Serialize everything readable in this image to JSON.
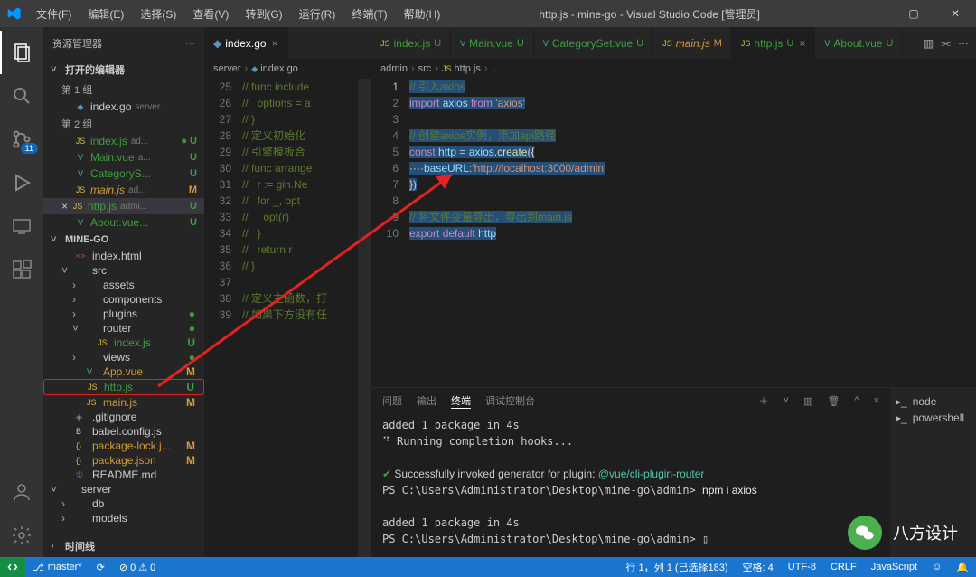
{
  "window": {
    "title": "http.js - mine-go - Visual Studio Code [管理员]"
  },
  "menubar": [
    "文件(F)",
    "编辑(E)",
    "选择(S)",
    "查看(V)",
    "转到(G)",
    "运行(R)",
    "终端(T)",
    "帮助(H)"
  ],
  "sidebar": {
    "title": "资源管理器",
    "open_editors": "打开的编辑器",
    "group1": "第 1 组",
    "group2": "第 2 组",
    "open_files_g1": [
      {
        "icon": "go",
        "name": "index.go",
        "path": "server",
        "status": ""
      }
    ],
    "open_files_g2": [
      {
        "icon": "js",
        "name": "index.js",
        "path": "ad...",
        "status": "U",
        "dot": true
      },
      {
        "icon": "vue",
        "name": "Main.vue",
        "path": "a...",
        "status": "U"
      },
      {
        "icon": "vue",
        "name": "CategoryS...",
        "path": "",
        "status": "U"
      },
      {
        "icon": "js",
        "name": "main.js",
        "path": "ad...",
        "status": "M",
        "italic": true
      },
      {
        "icon": "js",
        "name": "http.js",
        "path": "admi...",
        "status": "U",
        "active": true
      },
      {
        "icon": "vue",
        "name": "About.vue...",
        "path": "",
        "status": "U"
      }
    ],
    "workspace": "MINE-GO",
    "tree": [
      {
        "depth": 1,
        "icon": "html",
        "name": "index.html",
        "chev": ""
      },
      {
        "depth": 1,
        "icon": "folder",
        "name": "src",
        "chev": "v"
      },
      {
        "depth": 2,
        "icon": "folder",
        "name": "assets",
        "chev": ">"
      },
      {
        "depth": 2,
        "icon": "folder",
        "name": "components",
        "chev": ">"
      },
      {
        "depth": 2,
        "icon": "folder",
        "name": "plugins",
        "chev": ">",
        "dot": true
      },
      {
        "depth": 2,
        "icon": "folder",
        "name": "router",
        "chev": "v",
        "dot": true
      },
      {
        "depth": 3,
        "icon": "js",
        "name": "index.js",
        "status": "U"
      },
      {
        "depth": 2,
        "icon": "folder",
        "name": "views",
        "chev": ">",
        "dot": true
      },
      {
        "depth": 2,
        "icon": "vue",
        "name": "App.vue",
        "status": "M"
      },
      {
        "depth": 2,
        "icon": "js",
        "name": "http.js",
        "status": "U",
        "highlight": true
      },
      {
        "depth": 2,
        "icon": "js",
        "name": "main.js",
        "status": "M"
      },
      {
        "depth": 1,
        "icon": "git",
        "name": ".gitignore"
      },
      {
        "depth": 1,
        "icon": "js",
        "name": "babel.config.js",
        "iconChar": "B"
      },
      {
        "depth": 1,
        "icon": "json",
        "name": "package-lock.j...",
        "status": "M"
      },
      {
        "depth": 1,
        "icon": "json",
        "name": "package.json",
        "status": "M"
      },
      {
        "depth": 1,
        "icon": "md",
        "name": "README.md"
      },
      {
        "depth": 0,
        "icon": "folder",
        "name": "server",
        "chev": "v"
      },
      {
        "depth": 1,
        "icon": "folder",
        "name": "db",
        "chev": ">"
      },
      {
        "depth": 1,
        "icon": "folder",
        "name": "models",
        "chev": ">"
      }
    ],
    "timeline": "时间线"
  },
  "editor_left": {
    "tab": "index.go",
    "breadcrumb": [
      "server",
      "index.go"
    ],
    "lines": [
      {
        "n": 25,
        "t": "// func include"
      },
      {
        "n": 26,
        "t": "//   options = a"
      },
      {
        "n": 27,
        "t": "// }"
      },
      {
        "n": 28,
        "t": "// 定义初始化"
      },
      {
        "n": 29,
        "t": "// 引擎模板合"
      },
      {
        "n": 30,
        "t": "// func arrange"
      },
      {
        "n": 31,
        "t": "//   r := gin.Ne"
      },
      {
        "n": 32,
        "t": "//   for _, opt"
      },
      {
        "n": 33,
        "t": "//     opt(r)"
      },
      {
        "n": 34,
        "t": "//   }"
      },
      {
        "n": 35,
        "t": "//   return r"
      },
      {
        "n": 36,
        "t": "// }"
      },
      {
        "n": 37,
        "t": ""
      },
      {
        "n": 38,
        "t": "// 定义主函数，打"
      },
      {
        "n": 39,
        "t": "// 如果下方没有任"
      }
    ]
  },
  "editor_right": {
    "tabs": [
      {
        "icon": "js",
        "name": "index.js",
        "status": "U"
      },
      {
        "icon": "vue",
        "name": "Main.vue",
        "status": "U"
      },
      {
        "icon": "vue",
        "name": "CategorySet.vue",
        "status": "U"
      },
      {
        "icon": "js",
        "name": "main.js",
        "status": "M",
        "italic": true
      },
      {
        "icon": "js",
        "name": "http.js",
        "status": "U",
        "active": true
      },
      {
        "icon": "vue",
        "name": "About.vue",
        "status": "U"
      }
    ],
    "breadcrumb": [
      "admin",
      "src",
      "http.js",
      "..."
    ],
    "bc_icon_at": 2,
    "code": {
      "lines": [
        {
          "n": 1,
          "html": "<span class='sel'><span class='c-comment'>// 引入axios</span></span>"
        },
        {
          "n": 2,
          "html": "<span class='sel'><span class='c-keyword'>import</span> <span class='c-var'>axios</span> <span class='c-keyword'>from</span> <span class='c-string'>'axios'</span></span>"
        },
        {
          "n": 3,
          "html": ""
        },
        {
          "n": 4,
          "html": "<span class='sel'><span class='c-comment'>// 创建axios实例，添加api路径</span></span>"
        },
        {
          "n": 5,
          "html": "<span class='sel'><span class='c-keyword'>const</span> <span class='c-var'>http</span> = <span class='c-var'>axios</span>.<span class='c-func'>create</span>({</span>"
        },
        {
          "n": 6,
          "html": "<span class='sel'>····<span class='c-var'>baseURL</span>:<span class='c-string'>'http://localhost:3000/admin'</span></span>"
        },
        {
          "n": 7,
          "html": "<span class='sel'>})</span>"
        },
        {
          "n": 8,
          "html": ""
        },
        {
          "n": 9,
          "html": "<span class='sel'><span class='c-comment'>// 将文件变量导出，导出到main.js</span></span>"
        },
        {
          "n": 10,
          "html": "<span class='sel'><span class='c-keyword'>export</span> <span class='c-keyword'>default</span> <span class='c-var'>http</span></span>"
        }
      ]
    }
  },
  "panel": {
    "tabs": [
      "问题",
      "输出",
      "终端",
      "调试控制台"
    ],
    "active": 2,
    "lines": [
      "added 1 package in 4s",
      "⠙ Running completion hooks...",
      "",
      "✔<g> Successfully invoked generator for plugin: </g><c>@vue/cli-plugin-router</c>",
      "PS C:\\Users\\Administrator\\Desktop\\mine-go\\admin> <w>npm i axios</w>",
      "",
      "added 1 package in 4s",
      "PS C:\\Users\\Administrator\\Desktop\\mine-go\\admin> ▯"
    ],
    "side": [
      "node",
      "powershell"
    ],
    "actions": [
      "+",
      "v",
      "split",
      "trash",
      "^",
      "x"
    ]
  },
  "statusbar": {
    "left": [
      "master*",
      "⟳",
      "⊘ 0 ⚠ 0"
    ],
    "right": [
      "行 1，列 1 (已选择183)",
      "空格: 4",
      "UTF-8",
      "CRLF",
      "JavaScript",
      "☺",
      "🔔"
    ]
  },
  "scm_badge": "11",
  "watermark": "八方设计"
}
